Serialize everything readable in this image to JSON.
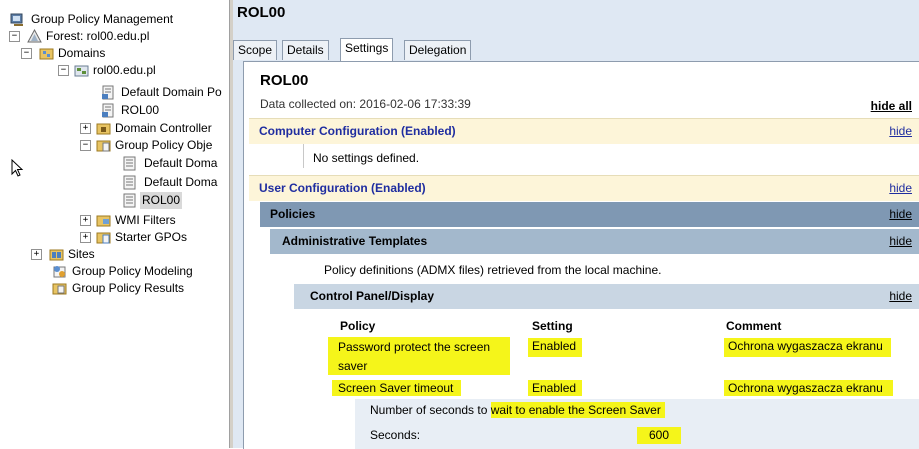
{
  "tree": {
    "items": [
      {
        "label": "Group Policy Management",
        "icon": "gpm-console-icon",
        "expander": ""
      },
      {
        "label": "Forest: rol00.edu.pl",
        "icon": "forest-icon",
        "expander": "−"
      },
      {
        "label": "Domains",
        "icon": "domains-folder-icon",
        "expander": "−"
      },
      {
        "label": "rol00.edu.pl",
        "icon": "domain-icon",
        "expander": "−"
      },
      {
        "label": "Default Domain Po",
        "icon": "gpo-link-icon",
        "expander": ""
      },
      {
        "label": "ROL00",
        "icon": "gpo-link-icon",
        "expander": ""
      },
      {
        "label": "Domain Controller",
        "icon": "ou-folder-icon",
        "expander": "+"
      },
      {
        "label": "Group Policy Obje",
        "icon": "gpo-folder-icon",
        "expander": "−"
      },
      {
        "label": "Default Doma",
        "icon": "gpo-icon",
        "expander": ""
      },
      {
        "label": "Default Doma",
        "icon": "gpo-icon",
        "expander": ""
      },
      {
        "label": "ROL00",
        "icon": "gpo-icon",
        "expander": "",
        "selected": true
      },
      {
        "label": "WMI Filters",
        "icon": "wmi-folder-icon",
        "expander": "+"
      },
      {
        "label": "Starter GPOs",
        "icon": "starter-folder-icon",
        "expander": "+"
      },
      {
        "label": "Sites",
        "icon": "sites-icon",
        "expander": "+"
      },
      {
        "label": "Group Policy Modeling",
        "icon": "modeling-icon",
        "expander": ""
      },
      {
        "label": "Group Policy Results",
        "icon": "results-icon",
        "expander": ""
      }
    ]
  },
  "header": {
    "title": "ROL00"
  },
  "tabs": [
    {
      "label": "Scope"
    },
    {
      "label": "Details"
    },
    {
      "label": "Settings",
      "active": true
    },
    {
      "label": "Delegation"
    }
  ],
  "report": {
    "title": "ROL00",
    "collected": "Data collected on: 2016-02-06 17:33:39",
    "hide_all": "hide all",
    "hide": "hide",
    "computer_config": "Computer Configuration (Enabled)",
    "no_settings": "No settings defined.",
    "user_config": "User Configuration (Enabled)",
    "policies": "Policies",
    "admin_templates": "Administrative Templates",
    "admx_note": "Policy definitions (ADMX files) retrieved from the local machine.",
    "control_panel": "Control Panel/Display",
    "columns": {
      "policy": "Policy",
      "setting": "Setting",
      "comment": "Comment"
    },
    "rows": [
      {
        "policy_line1": "Password protect the screen",
        "policy_line2": "saver",
        "setting": "Enabled",
        "comment": "Ochrona wygaszacza ekranu"
      },
      {
        "policy_line1": "Screen Saver timeout",
        "setting": "Enabled",
        "comment": "Ochrona wygaszacza ekranu"
      }
    ],
    "detail_prefix": "Number of seconds to ",
    "detail_highlight": "wait to enable the Screen Saver",
    "seconds_label": "Seconds:",
    "seconds_value": "600"
  }
}
